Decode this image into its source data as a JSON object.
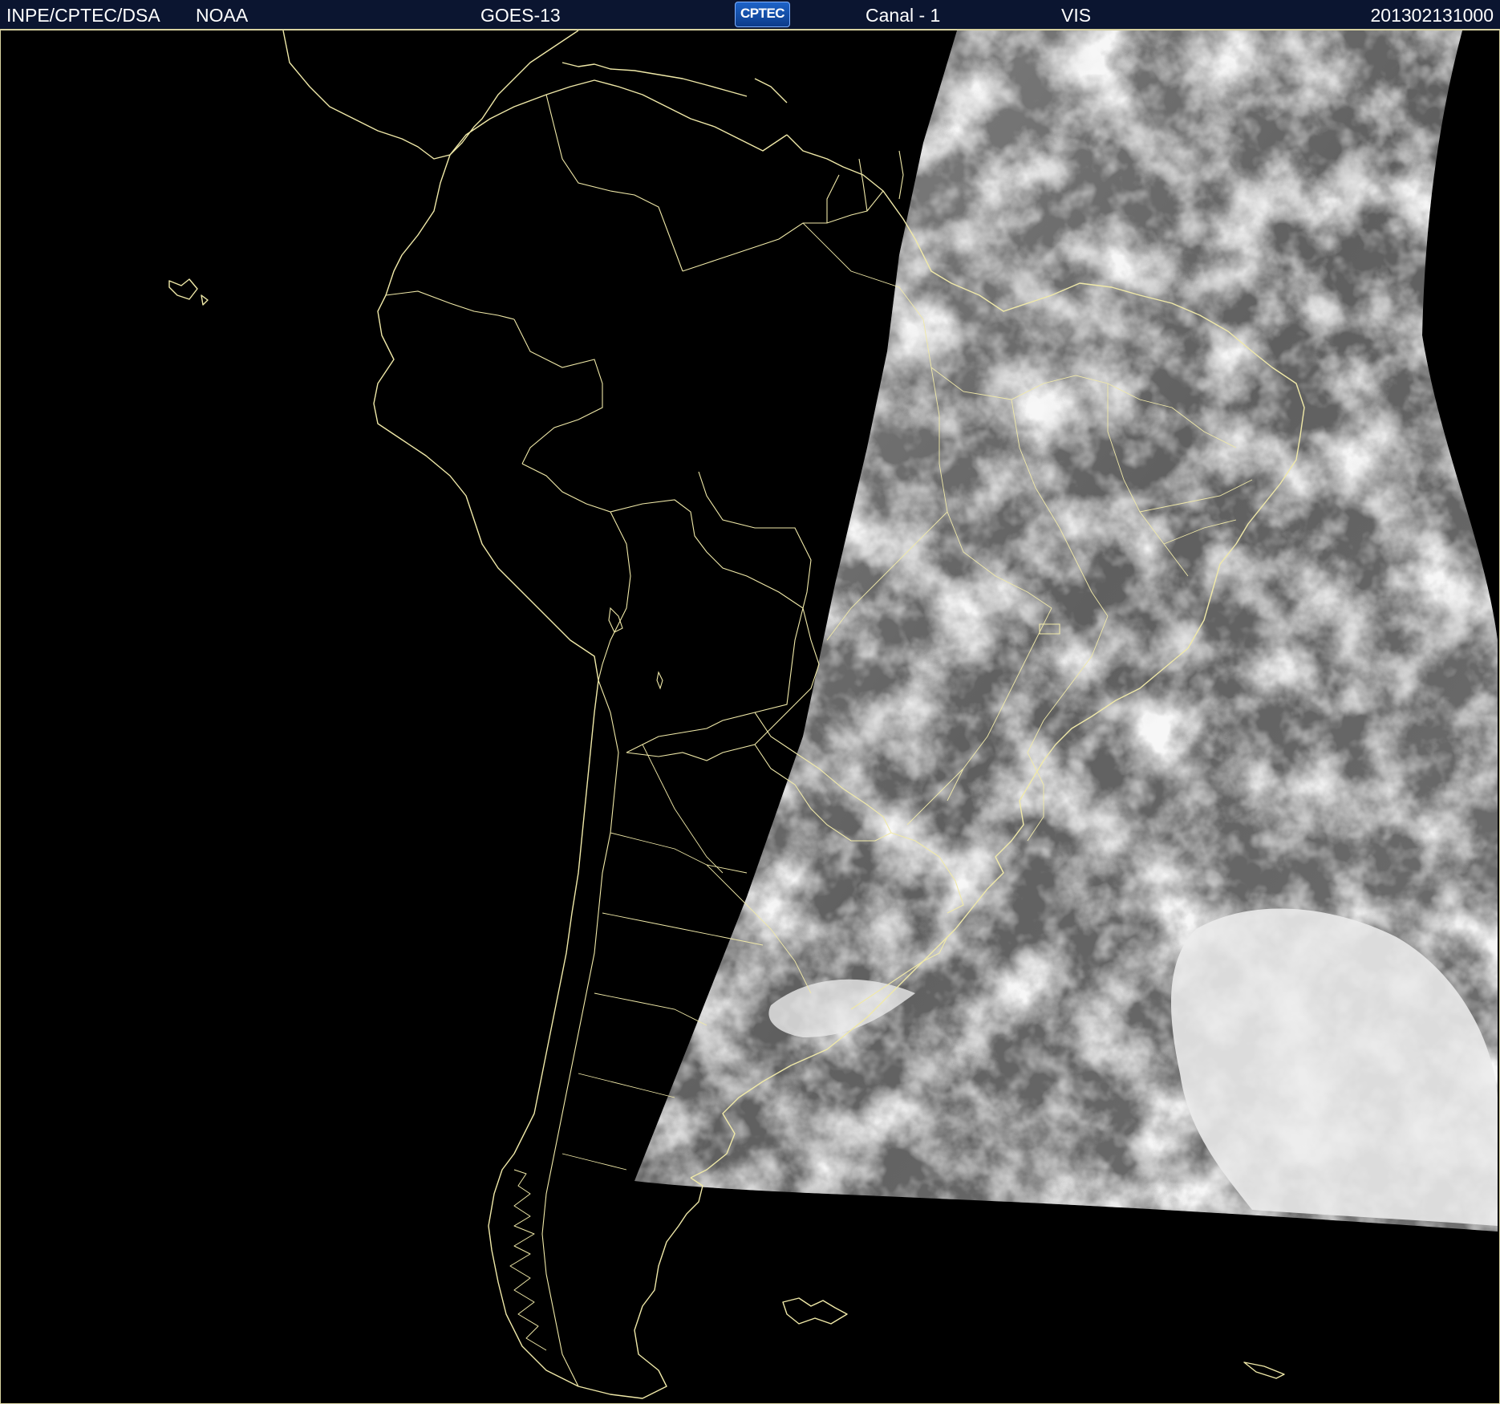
{
  "header": {
    "institution": "INPE/CPTEC/DSA",
    "agency": "NOAA",
    "satellite": "GOES-13",
    "logo_text": "CPTEC",
    "channel": "Canal - 1",
    "band": "VIS",
    "timestamp": "201302131000"
  },
  "map": {
    "region": "South America",
    "background_color": "#000000",
    "coastline_color": "#f0e9a8",
    "cloud_color": "#eeeeee",
    "ocean_color": "#6a6a6a"
  }
}
